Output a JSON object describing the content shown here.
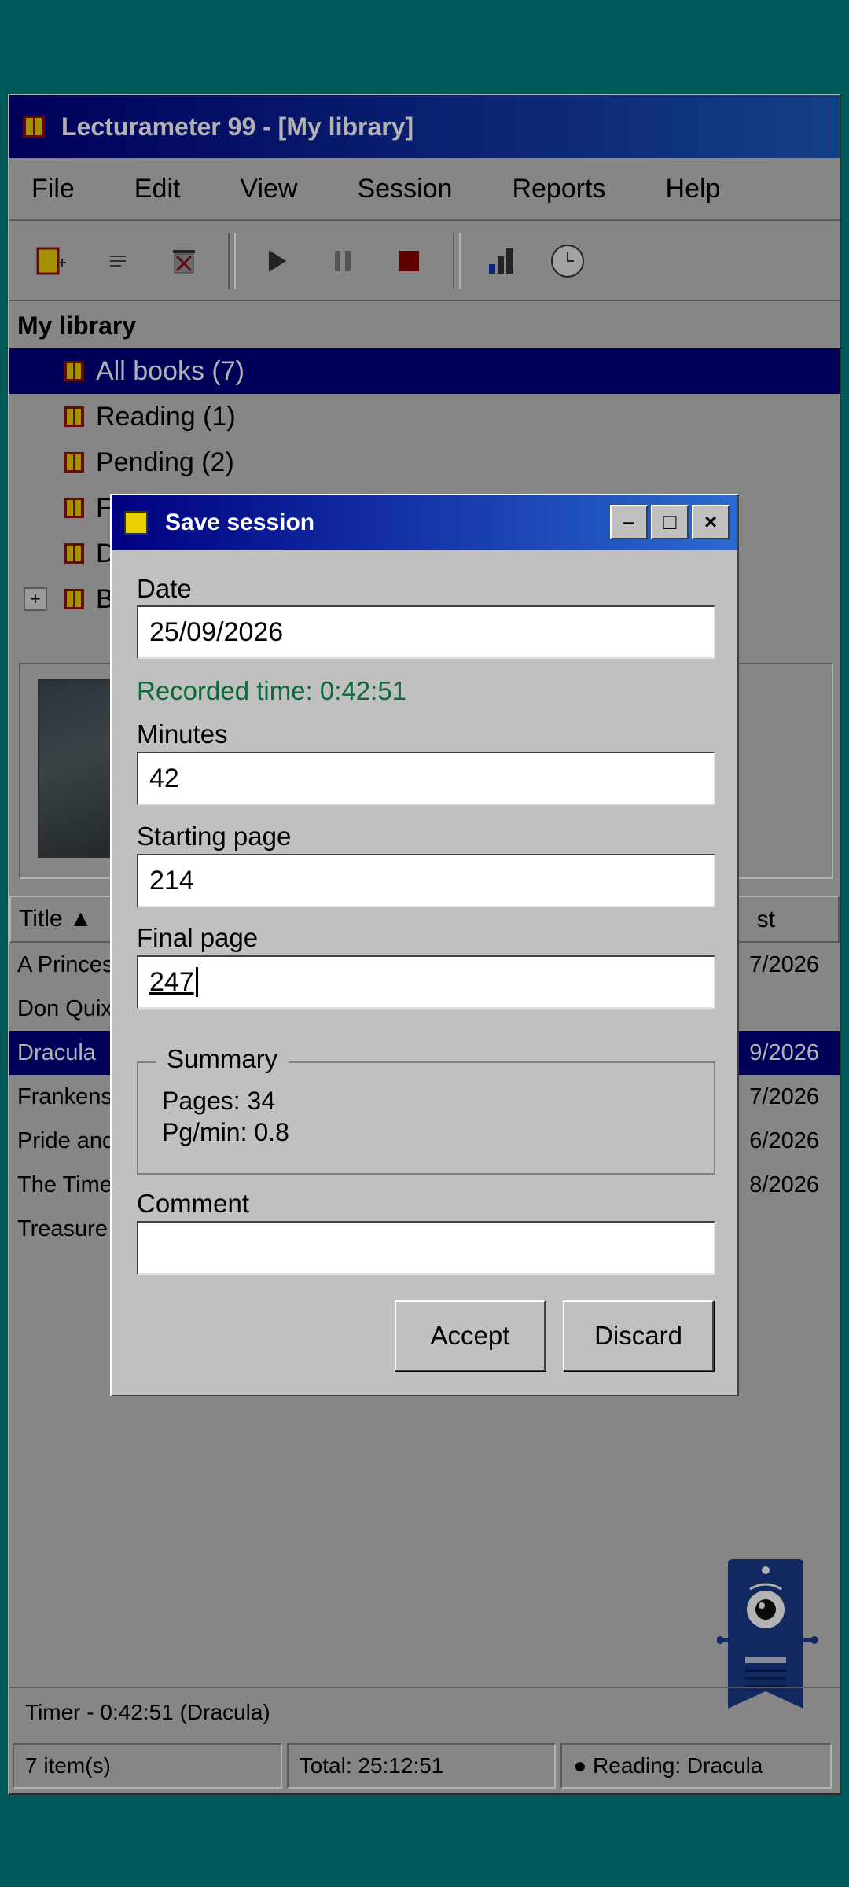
{
  "app": {
    "title": "Lecturameter 99 - [My library]"
  },
  "menu": [
    "File",
    "Edit",
    "View",
    "Session",
    "Reports",
    "Help"
  ],
  "toolbar": {
    "icons": [
      "new-book-icon",
      "list-icon",
      "delete-book-icon",
      "play-icon",
      "pause-icon",
      "stop-icon",
      "stats-icon",
      "history-clock-icon"
    ]
  },
  "tree": {
    "header": "My library",
    "items": [
      {
        "label": "All books (7)",
        "selected": true
      },
      {
        "label": "Reading (1)"
      },
      {
        "label": "Pending (2)"
      },
      {
        "label": "F"
      },
      {
        "label": "D"
      },
      {
        "label": "B",
        "expandable": true,
        "expander": "+"
      }
    ]
  },
  "list": {
    "header_title": "Title ▲",
    "header_last": "st",
    "rows": [
      {
        "title": "A Princes",
        "date": "7/2026"
      },
      {
        "title": "Don Quix",
        "date": ""
      },
      {
        "title": "Dracula",
        "date": "9/2026",
        "selected": true
      },
      {
        "title": "Frankens",
        "date": "7/2026"
      },
      {
        "title": "Pride and",
        "date": "6/2026"
      },
      {
        "title": "The Time",
        "date": "8/2026"
      },
      {
        "title": "Treasure",
        "date": ""
      }
    ]
  },
  "timer": "Timer - 0:42:51 (Dracula)",
  "status": {
    "items": "7 item(s)",
    "total": "Total: 25:12:51",
    "reading": "● Reading: Dracula"
  },
  "dialog": {
    "title": "Save session",
    "minimize": "–",
    "maximize": "□",
    "close": "×",
    "date_label": "Date",
    "date_value": "25/09/2026",
    "recorded": "Recorded time: 0:42:51",
    "minutes_label": "Minutes",
    "minutes_value": "42",
    "start_label": "Starting page",
    "start_value": "214",
    "final_label": "Final page",
    "final_value": "247",
    "summary_legend": "Summary",
    "summary_pages": "Pages: 34",
    "summary_rate": "Pg/min: 0.8",
    "comment_label": "Comment",
    "comment_value": "",
    "accept": "Accept",
    "discard": "Discard"
  },
  "colors": {
    "desktop": "#008080",
    "title_bar": "#000080",
    "selection": "#000080",
    "recorded_text": "#0b6a3a"
  }
}
